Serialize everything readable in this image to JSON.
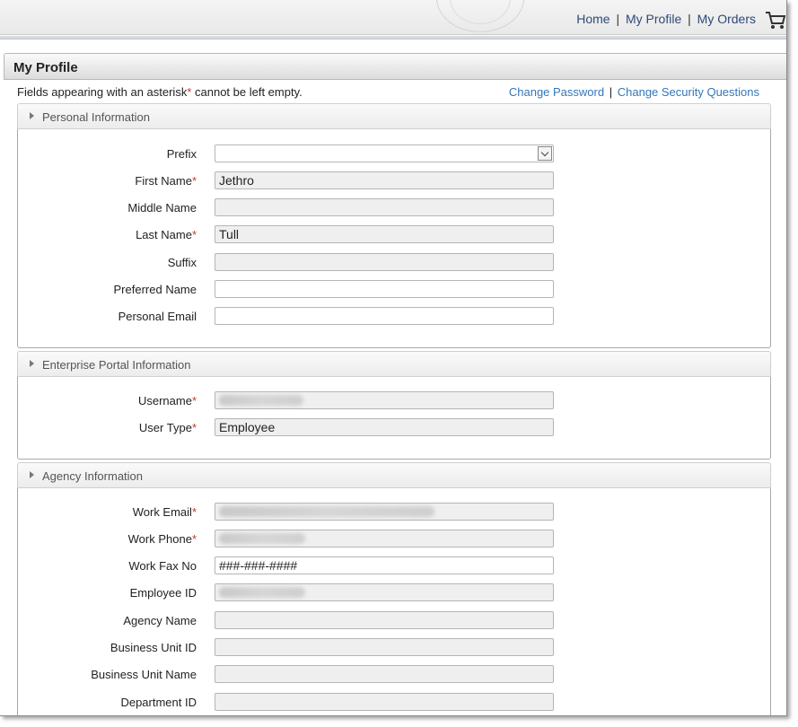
{
  "nav": {
    "home": "Home",
    "my_profile": "My Profile",
    "my_orders": "My Orders",
    "sep": "|"
  },
  "page": {
    "title": "My Profile",
    "notice_before": "Fields appearing with an asterisk",
    "notice_asterisk": "*",
    "notice_after": " cannot be left empty.",
    "change_password": "Change Password",
    "change_security": "Change Security Questions"
  },
  "sections": {
    "personal": {
      "title": "Personal Information",
      "fields": [
        {
          "label": "Prefix",
          "required": false,
          "value": ""
        },
        {
          "label": "First Name",
          "required": true,
          "value": "Jethro"
        },
        {
          "label": "Middle Name",
          "required": false,
          "value": ""
        },
        {
          "label": "Last Name",
          "required": true,
          "value": "Tull"
        },
        {
          "label": "Suffix",
          "required": false,
          "value": ""
        },
        {
          "label": "Preferred Name",
          "required": false,
          "value": ""
        },
        {
          "label": "Personal Email",
          "required": false,
          "value": ""
        }
      ]
    },
    "portal": {
      "title": "Enterprise Portal Information",
      "fields": [
        {
          "label": "Username",
          "required": true,
          "value": ""
        },
        {
          "label": "User Type",
          "required": true,
          "value": "Employee"
        }
      ]
    },
    "agency": {
      "title": "Agency Information",
      "fields": [
        {
          "label": "Work Email",
          "required": true,
          "value": ""
        },
        {
          "label": "Work Phone",
          "required": true,
          "value": ""
        },
        {
          "label": "Work Fax No",
          "required": false,
          "value": "###-###-####"
        },
        {
          "label": "Employee ID",
          "required": false,
          "value": ""
        },
        {
          "label": "Agency Name",
          "required": false,
          "value": ""
        },
        {
          "label": "Business Unit ID",
          "required": false,
          "value": ""
        },
        {
          "label": "Business Unit Name",
          "required": false,
          "value": ""
        },
        {
          "label": "Department ID",
          "required": false,
          "value": ""
        }
      ]
    }
  },
  "required_mark": "*",
  "icons": {
    "cart": "shopping-cart-icon",
    "seal": "state-seal-logo",
    "section_toggle": "triangle-right-icon",
    "select_arrow": "chevron-down-icon"
  },
  "colors": {
    "link": "#2b4a78",
    "top_link": "#3477b8",
    "required": "#c0392b",
    "readonly_field": "#efefef"
  }
}
